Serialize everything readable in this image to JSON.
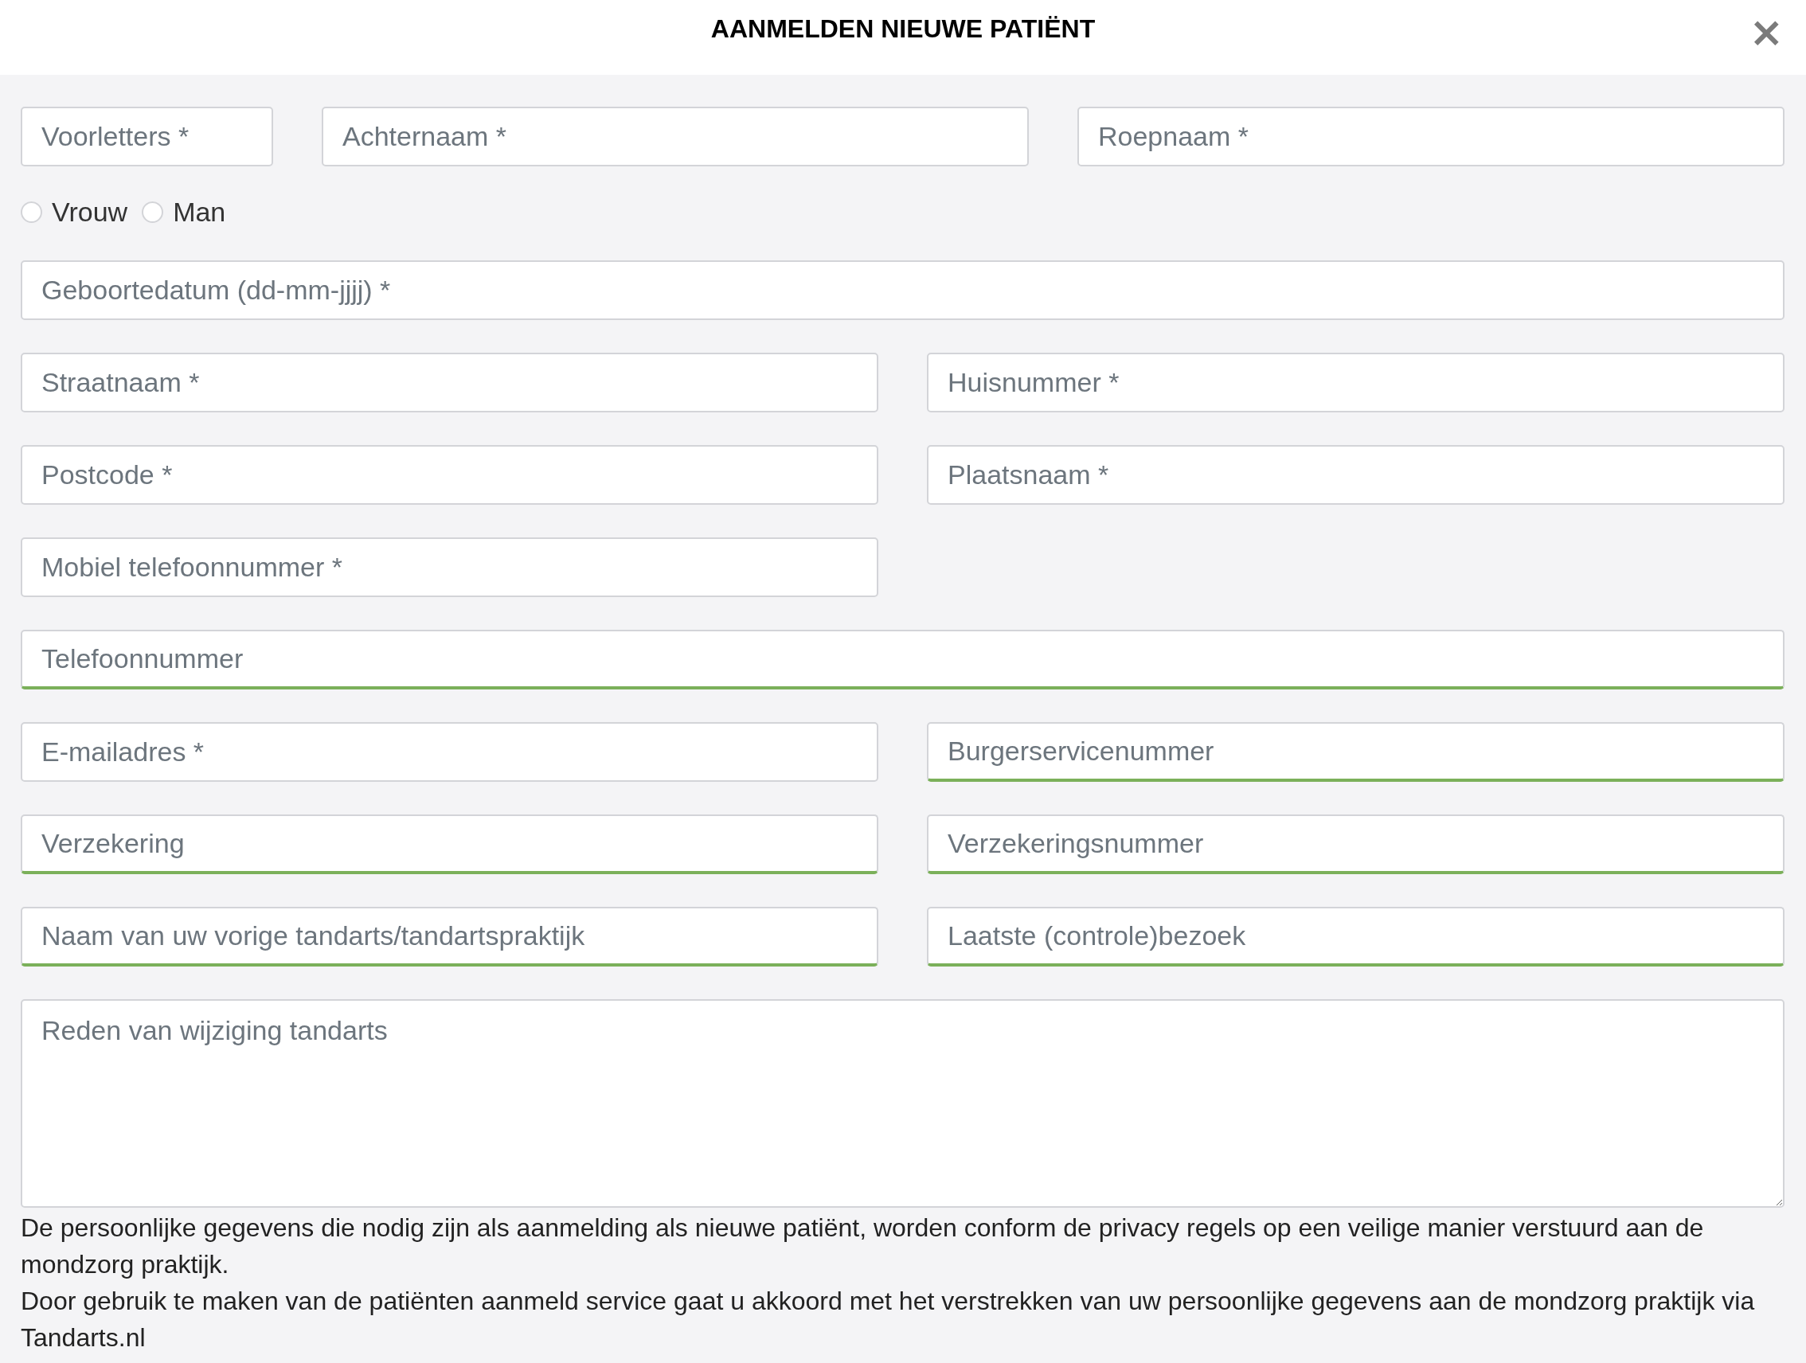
{
  "window": {
    "title": "AANMELDEN NIEUWE PATIËNT",
    "close": "×"
  },
  "rows": [
    {
      "kind": "names",
      "fields": [
        {
          "kind": "text",
          "placeholder": "Voorletters *",
          "valid": false
        },
        {
          "kind": "text",
          "placeholder": "Achternaam *",
          "valid": false
        },
        {
          "kind": "text",
          "placeholder": "Roepnaam *",
          "valid": false
        }
      ]
    },
    {
      "kind": "radios",
      "options": [
        {
          "label": "Vrouw",
          "selected": false
        },
        {
          "label": "Man",
          "selected": false
        }
      ]
    },
    {
      "kind": "full",
      "fields": [
        {
          "kind": "text",
          "placeholder": "Geboortedatum (dd-mm-jjjj) *",
          "valid": false
        }
      ]
    },
    {
      "kind": "halves",
      "fields": [
        {
          "kind": "text",
          "placeholder": "Straatnaam *",
          "valid": false
        },
        {
          "kind": "text",
          "placeholder": "Huisnummer *",
          "valid": false
        }
      ]
    },
    {
      "kind": "halves",
      "fields": [
        {
          "kind": "text",
          "placeholder": "Postcode *",
          "valid": false
        },
        {
          "kind": "text",
          "placeholder": "Plaatsnaam *",
          "valid": false
        }
      ]
    },
    {
      "kind": "halves",
      "fields": [
        {
          "kind": "text",
          "placeholder": "Mobiel telefoonnummer *",
          "valid": false
        }
      ]
    },
    {
      "kind": "full",
      "fields": [
        {
          "kind": "text",
          "placeholder": "Telefoonnummer",
          "valid": true
        }
      ]
    },
    {
      "kind": "halves",
      "fields": [
        {
          "kind": "text",
          "placeholder": "E-mailadres *",
          "valid": false
        },
        {
          "kind": "text",
          "placeholder": "Burgerservicenummer",
          "valid": true
        }
      ]
    },
    {
      "kind": "halves",
      "fields": [
        {
          "kind": "text",
          "placeholder": "Verzekering",
          "valid": true
        },
        {
          "kind": "text",
          "placeholder": "Verzekeringsnummer",
          "valid": true
        }
      ]
    },
    {
      "kind": "halves",
      "fields": [
        {
          "kind": "text",
          "placeholder": "Naam van uw vorige tandarts/tandartspraktijk",
          "valid": true
        },
        {
          "kind": "text",
          "placeholder": "Laatste (controle)bezoek",
          "valid": true
        }
      ]
    },
    {
      "kind": "full",
      "fields": [
        {
          "kind": "textarea",
          "placeholder": "Reden van wijziging tandarts",
          "valid": false
        }
      ]
    }
  ],
  "notes": [
    "De persoonlijke gegevens die nodig zijn als aanmelding als nieuwe patiënt, worden conform de privacy regels op een veilige manier verstuurd aan de mondzorg praktijk.",
    "Door gebruik te maken van de patiënten aanmeld service gaat u akkoord met het verstrekken van uw persoonlijke gegevens aan de mondzorg praktijk via Tandarts.nl"
  ]
}
